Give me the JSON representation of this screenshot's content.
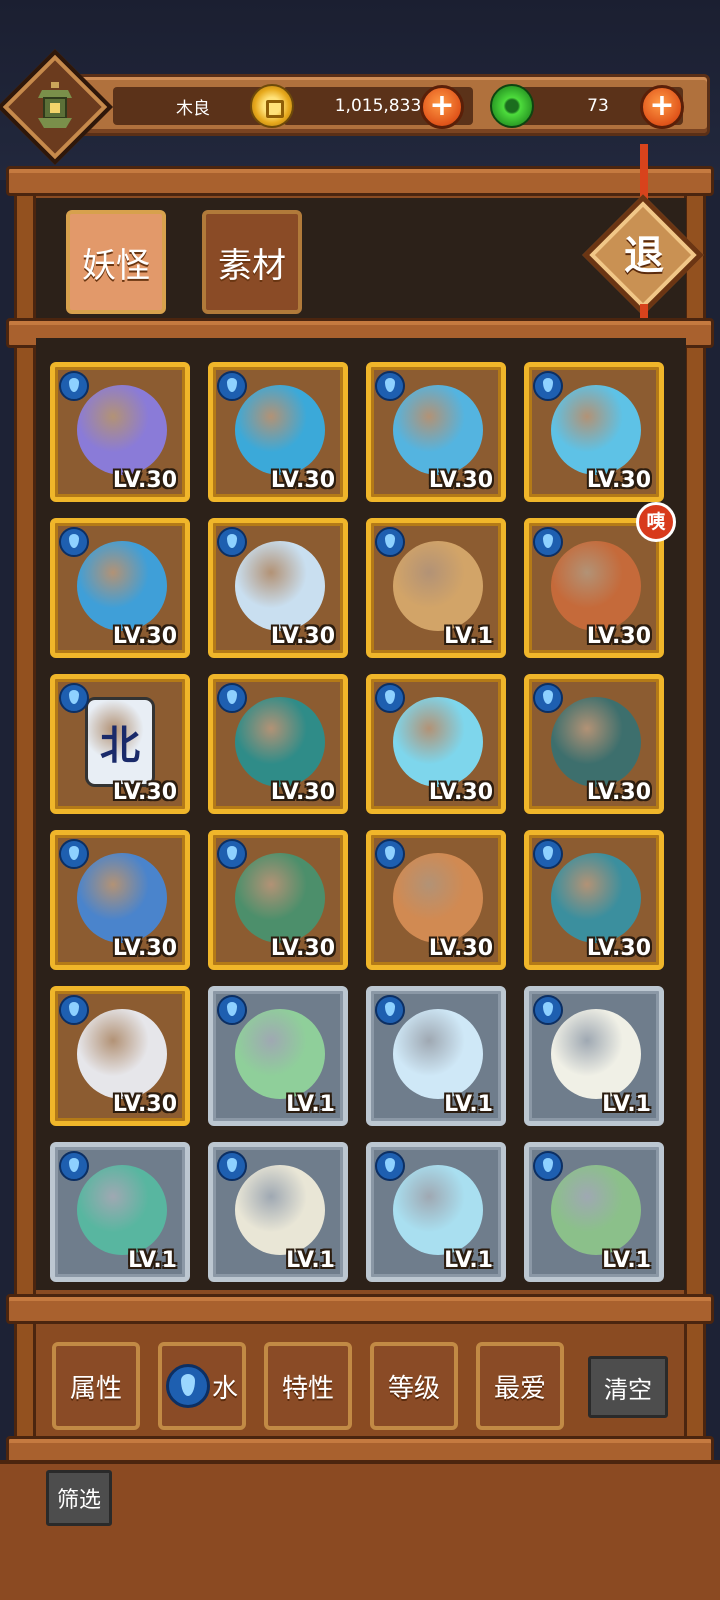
{
  "player": {
    "name": "木良",
    "avatar_icon": "lantern-icon"
  },
  "resources": {
    "coins": "1,015,833",
    "gems": "73",
    "coin_icon": "gold-coin-icon",
    "gem_icon": "jade-ring-icon",
    "add_label": "+"
  },
  "tabs": [
    {
      "label": "妖怪",
      "active": true
    },
    {
      "label": "素材",
      "active": false
    }
  ],
  "exit_label": "退",
  "element_icon": "water-drop-icon",
  "monsters": [
    {
      "level": "LV.30",
      "frame": "gold",
      "color": "#8a7bd8"
    },
    {
      "level": "LV.30",
      "frame": "gold",
      "color": "#3ba9d9"
    },
    {
      "level": "LV.30",
      "frame": "gold",
      "color": "#54b4e0"
    },
    {
      "level": "LV.30",
      "frame": "gold",
      "color": "#5ec2e6"
    },
    {
      "level": "LV.30",
      "frame": "gold",
      "color": "#3f9fd8"
    },
    {
      "level": "LV.30",
      "frame": "gold",
      "color": "#c9dff0"
    },
    {
      "level": "LV.1",
      "frame": "gold",
      "color": "#d2a468"
    },
    {
      "level": "LV.30",
      "frame": "gold",
      "color": "#c56a3a",
      "badge": "咦"
    },
    {
      "level": "LV.30",
      "frame": "gold",
      "color": "#e8eef5",
      "tile_text": "北"
    },
    {
      "level": "LV.30",
      "frame": "gold",
      "color": "#2f8c88"
    },
    {
      "level": "LV.30",
      "frame": "gold",
      "color": "#7ed6ec"
    },
    {
      "level": "LV.30",
      "frame": "gold",
      "color": "#3d6f6d"
    },
    {
      "level": "LV.30",
      "frame": "gold",
      "color": "#4a84cc"
    },
    {
      "level": "LV.30",
      "frame": "gold",
      "color": "#4c8f6b"
    },
    {
      "level": "LV.30",
      "frame": "gold",
      "color": "#d18a52"
    },
    {
      "level": "LV.30",
      "frame": "gold",
      "color": "#3b8f9e"
    },
    {
      "level": "LV.30",
      "frame": "gold",
      "color": "#e6e6ea"
    },
    {
      "level": "LV.1",
      "frame": "silver",
      "color": "#8fcf9a"
    },
    {
      "level": "LV.1",
      "frame": "silver",
      "color": "#cfe8f7"
    },
    {
      "level": "LV.1",
      "frame": "silver",
      "color": "#f0f0e6"
    },
    {
      "level": "LV.1",
      "frame": "silver",
      "color": "#58b6a0"
    },
    {
      "level": "LV.1",
      "frame": "silver",
      "color": "#e9e6d6"
    },
    {
      "level": "LV.1",
      "frame": "silver",
      "color": "#a9dff0"
    },
    {
      "level": "LV.1",
      "frame": "silver",
      "color": "#8bc08a"
    }
  ],
  "filters": [
    {
      "label": "属性"
    },
    {
      "label": "水",
      "icon": "water-drop-icon"
    },
    {
      "label": "特性"
    },
    {
      "label": "等级"
    },
    {
      "label": "最爱"
    }
  ],
  "clear_label": "清空",
  "screen_label": "筛选"
}
